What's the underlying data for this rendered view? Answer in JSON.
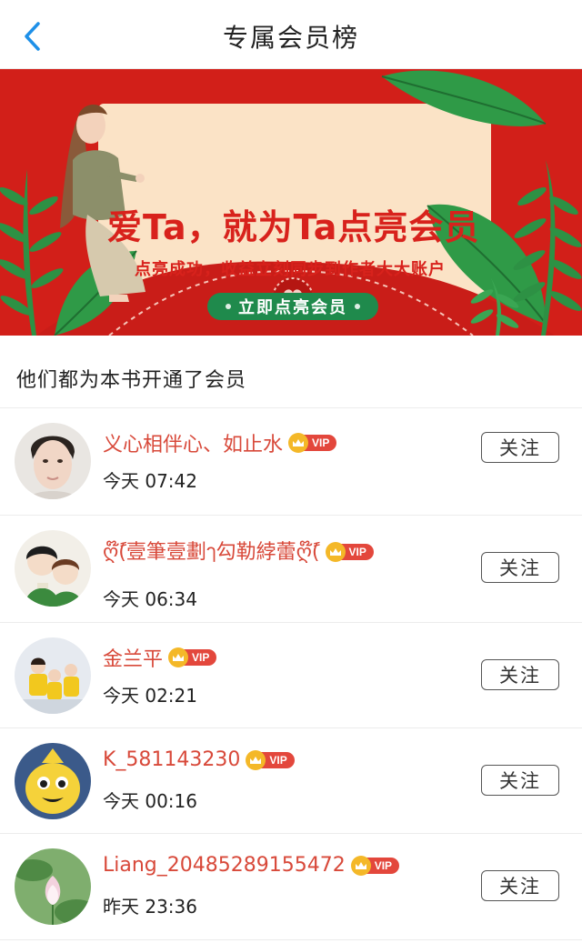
{
  "header": {
    "title": "专属会员榜"
  },
  "banner": {
    "headline": "爱Ta，就为Ta点亮会员",
    "subtitle": "点亮成功，收益立刻同步到作者大大账户",
    "cta_label": "立即点亮会员"
  },
  "section_title": "他们都为本书开通了会员",
  "vip_label": "VIP",
  "members": [
    {
      "name": "义心相伴心、如止水",
      "time": "今天 07:42",
      "follow_label": "关注"
    },
    {
      "name": "ღًً໊(壹筆壹劃ๅ勾勒綍蕾ღًً໊(",
      "time": "今天 06:34",
      "follow_label": "关注"
    },
    {
      "name": "金兰平",
      "time": "今天 02:21",
      "follow_label": "关注"
    },
    {
      "name": "K_581143230",
      "time": "今天 00:16",
      "follow_label": "关注"
    },
    {
      "name": "Liang_20485289155472",
      "time": "昨天 23:36",
      "follow_label": "关注"
    }
  ],
  "colors": {
    "accent_red": "#d8221c",
    "name_red": "#d8493a",
    "cta_green": "#1f8a4c",
    "vip_gold": "#f4b828",
    "back_blue": "#1e90e8"
  }
}
